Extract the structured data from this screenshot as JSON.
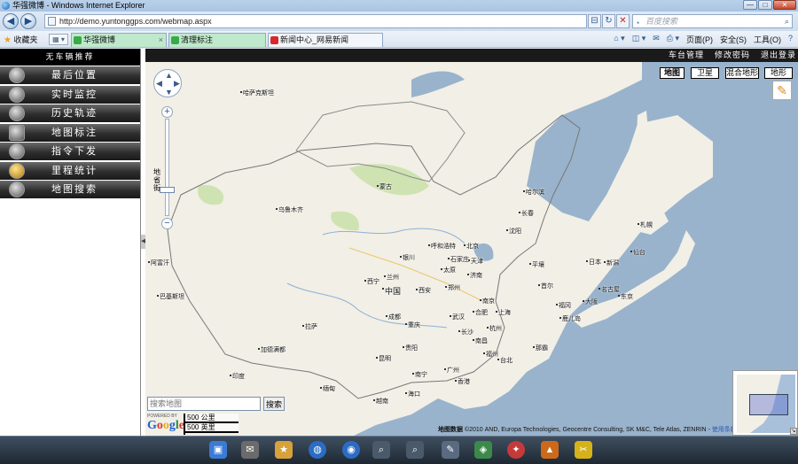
{
  "window": {
    "title": "华强微博 - Windows Internet Explorer",
    "minimize": "—",
    "maximize": "□",
    "close": "✕"
  },
  "address": {
    "url": "http://demo.yuntonggps.com/webmap.aspx",
    "search_placeholder": "百度搜索",
    "back": "◀",
    "forward": "▶",
    "refresh": "↻",
    "stop": "✕",
    "compat": "⊟",
    "search_go": "⌕"
  },
  "favorites": {
    "label": "收藏夹",
    "grid": "▦ ▾"
  },
  "tabs": [
    {
      "label": "华强微博",
      "close": "×"
    },
    {
      "label": "清理标注"
    },
    {
      "label": "新闻中心_网易新闻"
    }
  ],
  "commands": {
    "page": "页面(P)",
    "safety": "安全(S)",
    "tools": "工具(O)",
    "help": "?"
  },
  "sidebar": {
    "header": "无车辆推荐",
    "items": [
      {
        "label": "最后位置"
      },
      {
        "label": "实时监控"
      },
      {
        "label": "历史轨迹"
      },
      {
        "label": "地图标注"
      },
      {
        "label": "指令下发"
      },
      {
        "label": "里程统计"
      },
      {
        "label": "地图搜索"
      }
    ]
  },
  "toplinks": {
    "vehicle_mgmt": "车台管理",
    "change_pwd": "修改密码",
    "logout": "退出登录"
  },
  "map": {
    "types": [
      "地图",
      "卫星",
      "混合地形",
      "地形"
    ],
    "active_type": "地图",
    "zoom_labels": "地省街",
    "search_placeholder": "搜索地图",
    "search_button": "搜索",
    "powered_by": "POWERED BY",
    "logo": {
      "g1": "G",
      "o1": "o",
      "o2": "o",
      "g2": "g",
      "l": "l",
      "e": "e"
    },
    "scale": [
      "500 公里",
      "500 英里"
    ],
    "copyright_label": "地图数据",
    "copyright": "©2010 AND, Europa Technologies, Geocentre Consulting, SK M&C, Tele Atlas, ZENRIN -",
    "terms": "使用条款",
    "pan": {
      "up": "▲",
      "down": "▼",
      "left": "◀",
      "right": "▶"
    },
    "zoom_in": "+",
    "zoom_out": "−",
    "overview_toggle": "↘",
    "pencil": "✎",
    "places": [
      {
        "name": "哈萨克斯坦",
        "key": "kaz"
      },
      {
        "name": "蒙古",
        "key": "mng"
      },
      {
        "name": "乌鲁木齐",
        "key": "urumqi"
      },
      {
        "name": "哈尔滨",
        "key": "harbin"
      },
      {
        "name": "长春",
        "key": "changchun"
      },
      {
        "name": "沈阳",
        "key": "shenyang"
      },
      {
        "name": "北京",
        "key": "beijing"
      },
      {
        "name": "天津",
        "key": "tianjin"
      },
      {
        "name": "呼和浩特",
        "key": "hohhot"
      },
      {
        "name": "银川",
        "key": "yinchuan"
      },
      {
        "name": "太原",
        "key": "taiyuan"
      },
      {
        "name": "石家庄",
        "key": "sjz"
      },
      {
        "name": "济南",
        "key": "jinan"
      },
      {
        "name": "兰州",
        "key": "lanzhou"
      },
      {
        "name": "西宁",
        "key": "xining"
      },
      {
        "name": "中国",
        "key": "china"
      },
      {
        "name": "西安",
        "key": "xian"
      },
      {
        "name": "郑州",
        "key": "zhengzhou"
      },
      {
        "name": "南京",
        "key": "nanjing"
      },
      {
        "name": "上海",
        "key": "shanghai"
      },
      {
        "name": "合肥",
        "key": "hefei"
      },
      {
        "name": "武汉",
        "key": "wuhan"
      },
      {
        "name": "杭州",
        "key": "hangzhou"
      },
      {
        "name": "成都",
        "key": "chengdu"
      },
      {
        "name": "重庆",
        "key": "chongqing"
      },
      {
        "name": "长沙",
        "key": "changsha"
      },
      {
        "name": "南昌",
        "key": "nanchang"
      },
      {
        "name": "福州",
        "key": "fuzhou"
      },
      {
        "name": "台北",
        "key": "taipei"
      },
      {
        "name": "贵阳",
        "key": "guiyang"
      },
      {
        "name": "昆明",
        "key": "kunming"
      },
      {
        "name": "南宁",
        "key": "nanning"
      },
      {
        "name": "广州",
        "key": "guangzhou"
      },
      {
        "name": "拉萨",
        "key": "lhasa"
      },
      {
        "name": "印度",
        "key": "india"
      },
      {
        "name": "加德满都",
        "key": "kathmandu"
      },
      {
        "name": "巴基斯坦",
        "key": "pakistan"
      },
      {
        "name": "阿富汗",
        "key": "afghanistan"
      },
      {
        "name": "首尔",
        "key": "seoul"
      },
      {
        "name": "平壤",
        "key": "pyongyang"
      },
      {
        "name": "日本",
        "key": "japan"
      },
      {
        "name": "东京",
        "key": "tokyo"
      },
      {
        "name": "大阪",
        "key": "osaka"
      },
      {
        "name": "名古屋",
        "key": "nagoya"
      },
      {
        "name": "札幌",
        "key": "sapporo"
      },
      {
        "name": "仙台",
        "key": "sendai"
      },
      {
        "name": "新潟",
        "key": "niigata"
      },
      {
        "name": "福冈",
        "key": "fukuoka"
      },
      {
        "name": "鹿儿岛",
        "key": "kagoshima"
      },
      {
        "name": "那霸",
        "key": "naha"
      },
      {
        "name": "海口",
        "key": "haikou"
      },
      {
        "name": "香港",
        "key": "hongkong"
      },
      {
        "name": "越南",
        "key": "vietnam"
      },
      {
        "name": "缅甸",
        "key": "myanmar"
      }
    ]
  },
  "taskbar": {
    "icons": [
      "▣",
      "✉",
      "★",
      "◍",
      "◉",
      "⌕",
      "⌕",
      "✎",
      "◈",
      "✦",
      "▲",
      "✂"
    ]
  }
}
